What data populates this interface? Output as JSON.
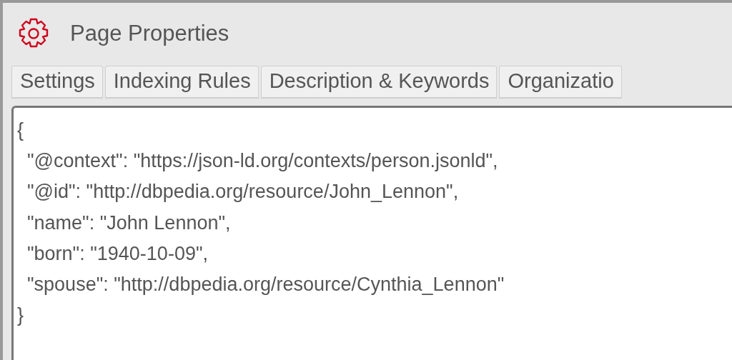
{
  "window": {
    "title": "Page Properties"
  },
  "tabs": [
    {
      "label": "Settings",
      "selected": false
    },
    {
      "label": "Indexing Rules",
      "selected": false
    },
    {
      "label": "Description & Keywords",
      "selected": false
    },
    {
      "label": "Organizatio",
      "selected": false
    }
  ],
  "editor": {
    "open": "{",
    "lines": [
      "\"@context\": \"https://json-ld.org/contexts/person.jsonld\",",
      "\"@id\": \"http://dbpedia.org/resource/John_Lennon\",",
      "\"name\": \"John Lennon\",",
      "\"born\": \"1940-10-09\",",
      "\"spouse\": \"http://dbpedia.org/resource/Cynthia_Lennon\""
    ],
    "close": "}"
  }
}
